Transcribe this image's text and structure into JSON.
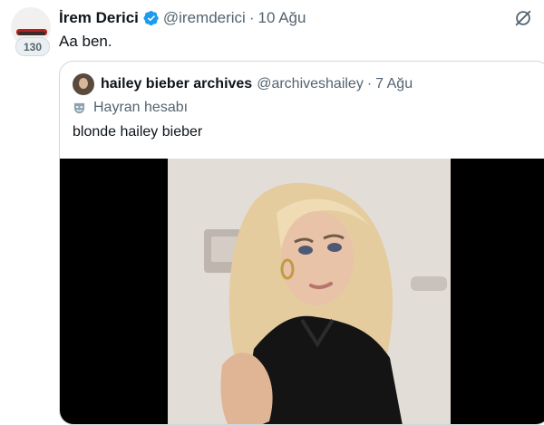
{
  "tweet": {
    "author_name": "İrem Derici",
    "author_handle": "@iremderici",
    "separator": "·",
    "date": "10 Ağu",
    "text": "Aa ben.",
    "avatar_badge": "130"
  },
  "quoted": {
    "author_name": "hailey bieber archives",
    "author_handle": "@archiveshailey",
    "separator": "·",
    "date": "7 Ağu",
    "label": "Hayran hesabı",
    "text": "blonde hailey bieber"
  },
  "colors": {
    "text_primary": "#0f1419",
    "text_secondary": "#536471",
    "verified_blue": "#1d9bf0",
    "border": "#cfd9de"
  },
  "icons": {
    "verified": "verified-badge-icon",
    "grok": "grok-icon",
    "fan_account": "mask-icon"
  }
}
